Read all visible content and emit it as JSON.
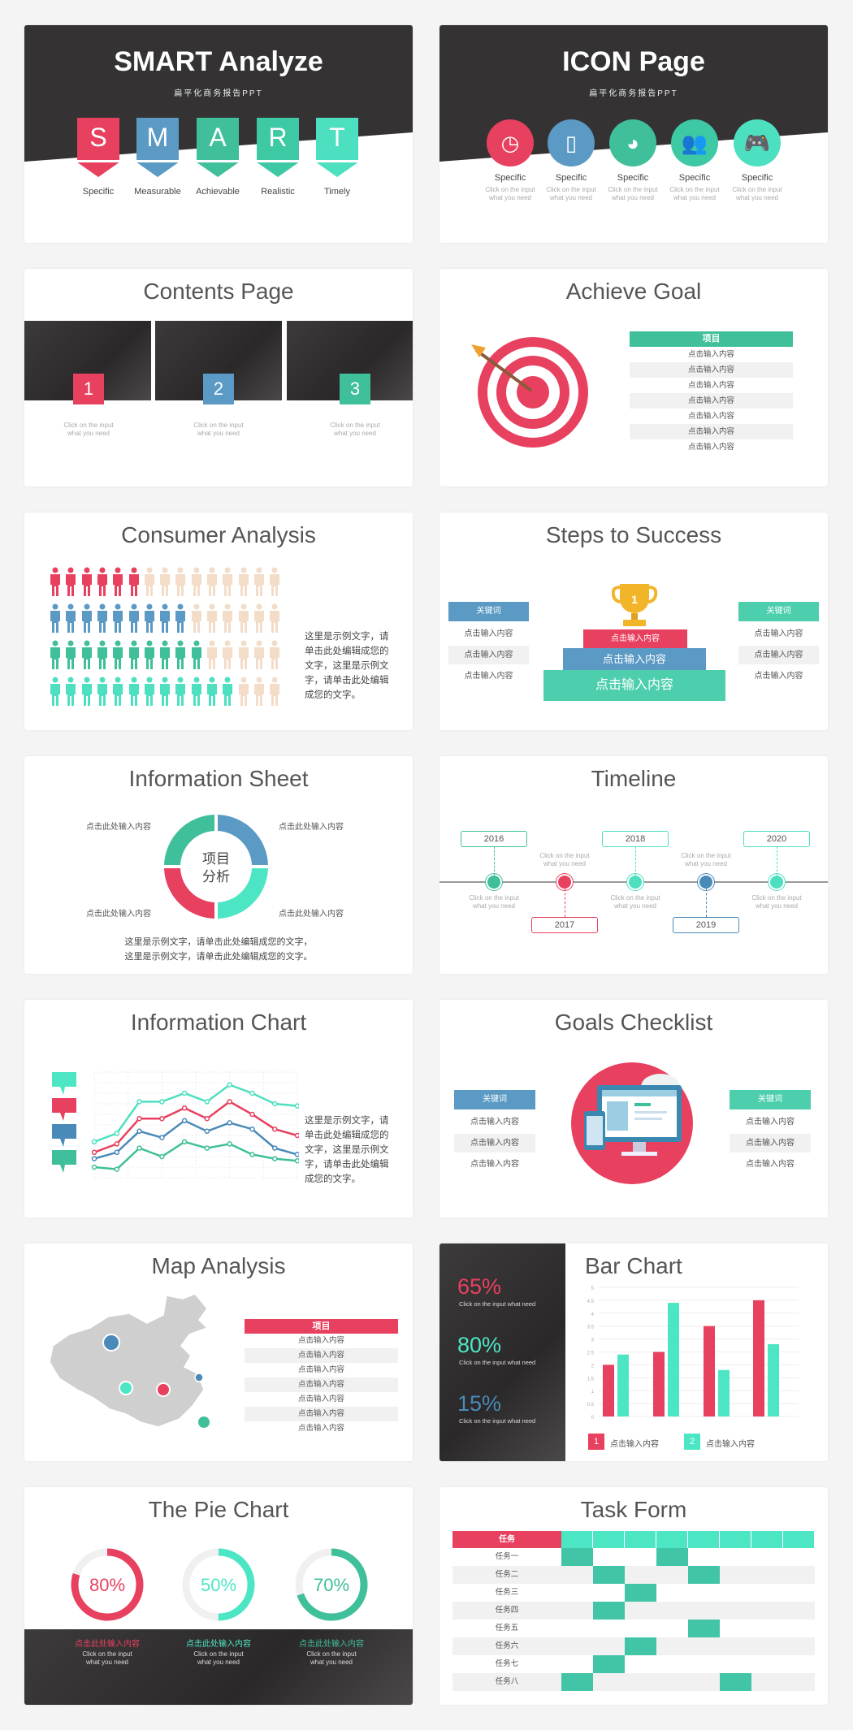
{
  "colors": {
    "red": "#e8405f",
    "blue": "#5b9ac4",
    "green": "#3fbf9a",
    "teal": "#4de6c4",
    "dark": "#333132",
    "gray": "#f1f1f1"
  },
  "smart": {
    "title": "SMART Analyze",
    "subtitle": "扁平化商务报告PPT",
    "letters": [
      {
        "l": "S",
        "label": "Specific",
        "color": "#e8405f"
      },
      {
        "l": "M",
        "label": "Measurable",
        "color": "#5b9ac4"
      },
      {
        "l": "A",
        "label": "Achievable",
        "color": "#3fbf9a"
      },
      {
        "l": "R",
        "label": "Realistic",
        "color": "#3ec9a5"
      },
      {
        "l": "T",
        "label": "Timely",
        "color": "#4de0c0"
      }
    ]
  },
  "icon_page": {
    "title": "ICON Page",
    "subtitle": "扁平化商务报告PPT",
    "items": [
      {
        "icon": "clock-icon",
        "label": "Specific",
        "cap1": "Click on the input",
        "cap2": "what you need",
        "color": "#e8405f"
      },
      {
        "icon": "phone-icon",
        "label": "Specific",
        "cap1": "Click on the input",
        "cap2": "what you need",
        "color": "#5b9ac4"
      },
      {
        "icon": "pie-icon",
        "label": "Specific",
        "cap1": "Click on the input",
        "cap2": "what you need",
        "color": "#3fbf9a"
      },
      {
        "icon": "users-icon",
        "label": "Specific",
        "cap1": "Click on the input",
        "cap2": "what you need",
        "color": "#3ec9a5"
      },
      {
        "icon": "gamepad-icon",
        "label": "Specific",
        "cap1": "Click on the input",
        "cap2": "what you need",
        "color": "#4de0c0"
      }
    ]
  },
  "contents": {
    "title": "Contents Page",
    "items": [
      {
        "n": "1",
        "color": "#e8405f",
        "cap1": "Click on the input",
        "cap2": "what you need"
      },
      {
        "n": "2",
        "color": "#5b9ac4",
        "cap1": "Click on the input",
        "cap2": "what you need"
      },
      {
        "n": "3",
        "color": "#3fbf9a",
        "cap1": "Click on the input",
        "cap2": "what you need"
      }
    ]
  },
  "achieve": {
    "title": "Achieve Goal",
    "header": "项目",
    "rows": [
      "点击输入内容",
      "点击输入内容",
      "点击输入内容",
      "点击输入内容",
      "点击输入内容",
      "点击输入内容",
      "点击输入内容"
    ]
  },
  "consumer": {
    "title": "Consumer Analysis",
    "rows": [
      {
        "count": 6,
        "color": "#e8405f"
      },
      {
        "count": 9,
        "color": "#5b9ac4"
      },
      {
        "count": 10,
        "color": "#3fbf9a"
      },
      {
        "count": 12,
        "color": "#4de0c0"
      }
    ],
    "total_per_row": 15,
    "text": "这里是示例文字，请单击此处编辑成您的文字，这里是示例文字，请单击此处编辑成您的文字。"
  },
  "steps": {
    "title": "Steps to Success",
    "trophy": "1",
    "levels": [
      "点击输入内容",
      "点击输入内容",
      "点击输入内容"
    ],
    "left": {
      "header": "关键词",
      "items": [
        "点击输入内容",
        "点击输入内容",
        "点击输入内容"
      ]
    },
    "right": {
      "header": "关键词",
      "items": [
        "点击输入内容",
        "点击输入内容",
        "点击输入内容"
      ]
    }
  },
  "info_sheet": {
    "title": "Information Sheet",
    "center1": "项目",
    "center2": "分析",
    "labels": [
      "点击此处输入内容",
      "点击此处输入内容",
      "点击此处输入内容",
      "点击此处输入内容"
    ],
    "line1": "这里是示例文字，请单击此处编辑成您的文字，",
    "line2": "这里是示例文字，请单击此处编辑成您的文字。"
  },
  "timeline": {
    "title": "Timeline",
    "points": [
      {
        "year": "2016",
        "pos": "top",
        "color": "#3fbf9a",
        "cap1": "Click on the input",
        "cap2": "what you need"
      },
      {
        "year": "2017",
        "pos": "bottom",
        "color": "#e8405f",
        "cap1": "Click on the input",
        "cap2": "what you need"
      },
      {
        "year": "2018",
        "pos": "top",
        "color": "#4de0c0",
        "cap1": "Click on the input",
        "cap2": "what you need"
      },
      {
        "year": "2019",
        "pos": "bottom",
        "color": "#4a8ab8",
        "cap1": "Click on the input",
        "cap2": "what you need"
      },
      {
        "year": "2020",
        "pos": "top",
        "color": "#4de0c0",
        "cap1": "Click on the input",
        "cap2": "what you need"
      }
    ]
  },
  "info_chart": {
    "title": "Information Chart",
    "text": "这里是示例文字，请单击此处编辑成您的文字，这里是示例文字，请单击此处编辑成您的文字。"
  },
  "goals": {
    "title": "Goals Checklist",
    "left": {
      "header": "关键词",
      "items": [
        "点击输入内容",
        "点击输入内容",
        "点击输入内容"
      ]
    },
    "right": {
      "header": "关键词",
      "items": [
        "点击输入内容",
        "点击输入内容",
        "点击输入内容"
      ]
    }
  },
  "map": {
    "title": "Map Analysis",
    "header": "项目",
    "rows": [
      "点击输入内容",
      "点击输入内容",
      "点击输入内容",
      "点击输入内容",
      "点击输入内容",
      "点击输入内容",
      "点击输入内容"
    ]
  },
  "bar": {
    "stats": [
      {
        "value": "65%",
        "color": "#e8405f",
        "cap": "Click on the input what need"
      },
      {
        "value": "80%",
        "color": "#4de6c4",
        "cap": "Click on the input what need"
      },
      {
        "value": "15%",
        "color": "#4a8ab8",
        "cap": "Click on the input what need"
      }
    ],
    "legend": [
      {
        "n": "1",
        "label": "点击输入内容",
        "color": "#e8405f"
      },
      {
        "n": "2",
        "label": "点击输入内容",
        "color": "#4de6c4"
      }
    ]
  },
  "pie": {
    "title": "The Pie Chart",
    "items": [
      {
        "value": 80,
        "label": "80%",
        "color": "#e8405f",
        "head": "点击此处输入内容",
        "cap1": "Click on the input",
        "cap2": "what you need"
      },
      {
        "value": 50,
        "label": "50%",
        "color": "#4de6c4",
        "head": "点击此处输入内容",
        "cap1": "Click on the input",
        "cap2": "what you need"
      },
      {
        "value": 70,
        "label": "70%",
        "color": "#3fbf9a",
        "head": "点击此处输入内容",
        "cap1": "Click on the input",
        "cap2": "what you need"
      }
    ]
  },
  "task": {
    "title": "Task Form",
    "header": "任务",
    "columns": 8,
    "rows": [
      {
        "name": "任务一",
        "filled": [
          0,
          3
        ]
      },
      {
        "name": "任务二",
        "filled": [
          1,
          4
        ]
      },
      {
        "name": "任务三",
        "filled": [
          2
        ]
      },
      {
        "name": "任务四",
        "filled": [
          1
        ]
      },
      {
        "name": "任务五",
        "filled": [
          4
        ]
      },
      {
        "name": "任务六",
        "filled": [
          2
        ]
      },
      {
        "name": "任务七",
        "filled": [
          1
        ]
      },
      {
        "name": "任务八",
        "filled": [
          0,
          5
        ]
      }
    ]
  },
  "chart_data": [
    {
      "type": "bar",
      "title": "Bar Chart",
      "ylim": [
        0,
        5
      ],
      "yticks": [
        "0",
        "0.5",
        "1",
        "1.5",
        "2",
        "2.5",
        "3",
        "3.5",
        "4",
        "4.5",
        "5"
      ],
      "grid": true,
      "legend_placement": "bottom",
      "categories": [
        "",
        "",
        "",
        ""
      ],
      "series": [
        {
          "name": "点击输入内容",
          "color": "#e8405f",
          "values": [
            2,
            2.5,
            3.5,
            4.5
          ]
        },
        {
          "name": "点击输入内容",
          "color": "#4de6c4",
          "values": [
            2.4,
            4.4,
            1.8,
            2.8
          ]
        }
      ]
    },
    {
      "type": "line",
      "grid": true,
      "ylim": [
        0,
        5
      ],
      "x": [
        1,
        2,
        3,
        4,
        5,
        6,
        7,
        8,
        9,
        10
      ],
      "series": [
        {
          "color": "#4de0c0",
          "values": [
            1.7,
            2.1,
            3.6,
            3.6,
            4.0,
            3.6,
            4.4,
            4.0,
            3.5,
            3.4
          ]
        },
        {
          "color": "#e8405f",
          "values": [
            1.2,
            1.6,
            2.8,
            2.8,
            3.3,
            2.8,
            3.6,
            3.0,
            2.3,
            2.0
          ]
        },
        {
          "color": "#4a8ab8",
          "values": [
            0.9,
            1.2,
            2.2,
            1.9,
            2.7,
            2.2,
            2.6,
            2.3,
            1.4,
            1.1
          ]
        },
        {
          "color": "#3fbf9a",
          "values": [
            0.5,
            0.4,
            1.4,
            1.0,
            1.7,
            1.4,
            1.6,
            1.1,
            0.9,
            0.8
          ]
        }
      ]
    }
  ]
}
